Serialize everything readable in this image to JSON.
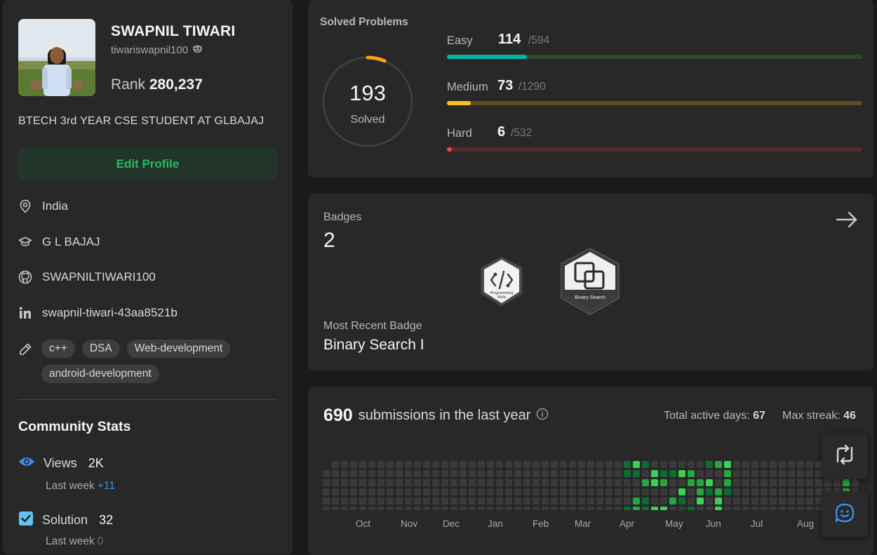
{
  "profile": {
    "name": "SWAPNIL TIWARI",
    "handle": "tiwariswapnil100",
    "rank_label": "Rank",
    "rank_value": "280,237",
    "bio": "BTECH 3rd YEAR CSE STUDENT AT GLBAJAJ",
    "edit_label": "Edit Profile",
    "location": "India",
    "school": "G L BAJAJ",
    "github": "SWAPNILTIWARI100",
    "linkedin": "swapnil-tiwari-43aa8521b",
    "skills": [
      "c++",
      "DSA",
      "Web-development",
      "android-development"
    ]
  },
  "community": {
    "title": "Community Stats",
    "views_label": "Views",
    "views_value": "2K",
    "views_week_label": "Last week",
    "views_week_value": "+11",
    "solution_label": "Solution",
    "solution_value": "32",
    "solution_week_label": "Last week",
    "solution_week_value": "0"
  },
  "solved": {
    "title": "Solved Problems",
    "total": "193",
    "total_label": "Solved",
    "total_fraction": 0.063,
    "easy": {
      "label": "Easy",
      "count": "114",
      "total": "/594",
      "fraction": 0.192,
      "color": "#00b8a3",
      "track": "#2a4a2f"
    },
    "medium": {
      "label": "Medium",
      "count": "73",
      "total": "/1290",
      "fraction": 0.057,
      "color": "#ffc01e",
      "track": "#5e4e1f"
    },
    "hard": {
      "label": "Hard",
      "count": "6",
      "total": "/532",
      "fraction": 0.011,
      "color": "#ef4743",
      "track": "#5a2b2b"
    }
  },
  "badges": {
    "title": "Badges",
    "count": "2",
    "badge1_text1": "Programming",
    "badge1_text2": "Skills",
    "badge2_text": "Binary Search",
    "recent_label": "Most Recent Badge",
    "recent_name": "Binary Search I"
  },
  "submissions": {
    "count": "690",
    "label": "submissions in the last year",
    "active_label": "Total active days:",
    "active_value": "67",
    "streak_label": "Max streak:",
    "streak_value": "46",
    "months": [
      "Oct",
      "Nov",
      "Dec",
      "Jan",
      "Feb",
      "Mar",
      "Apr",
      "May",
      "Jun",
      "Jul",
      "Aug"
    ]
  },
  "colors": {
    "accent_green": "#2cbb5d",
    "accent_blue": "#3b8ee8"
  }
}
